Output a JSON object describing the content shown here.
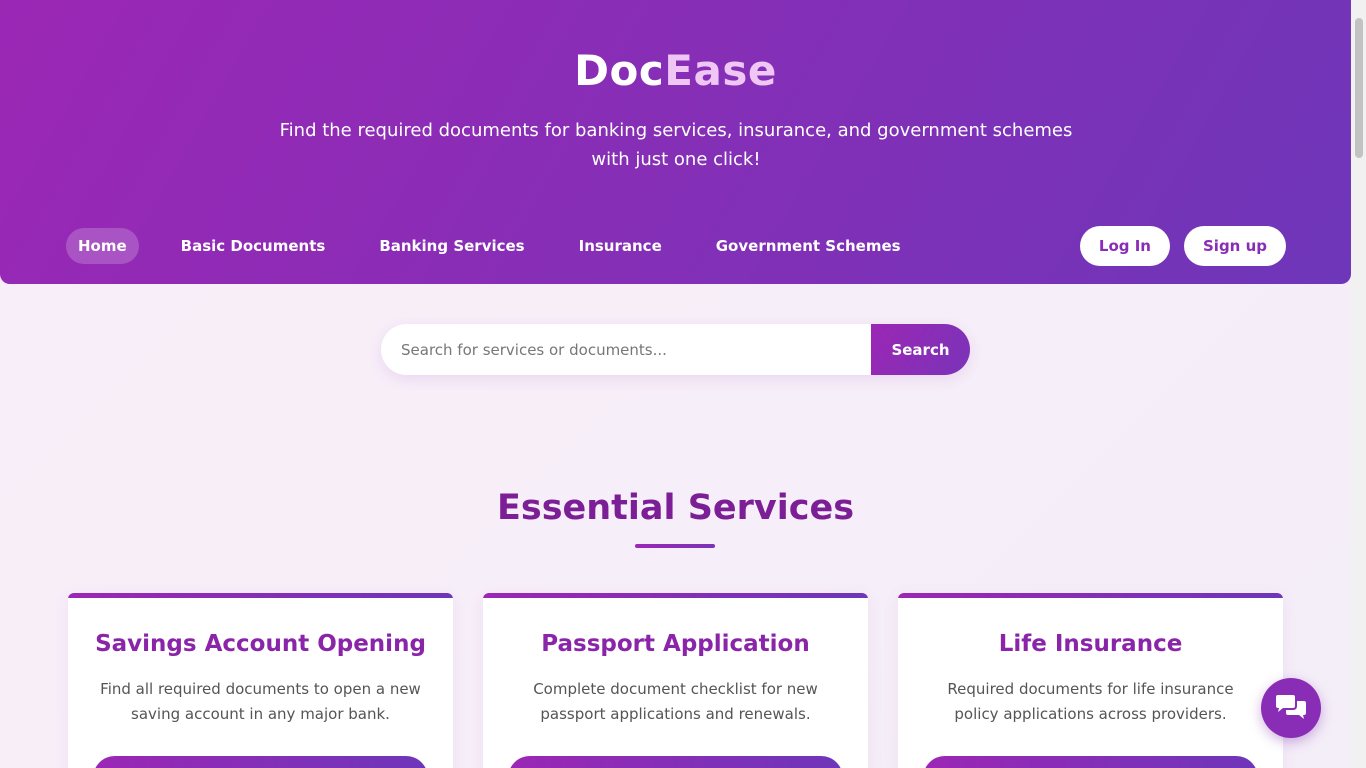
{
  "header": {
    "logo_part1": "Doc",
    "logo_part2": "Ease",
    "tagline": "Find the required documents for banking services, insurance, and government schemes with just one click!"
  },
  "nav": {
    "items": [
      {
        "label": "Home",
        "active": true
      },
      {
        "label": "Basic Documents"
      },
      {
        "label": "Banking Services"
      },
      {
        "label": "Insurance"
      },
      {
        "label": "Government Schemes"
      }
    ],
    "login_label": "Log In",
    "signup_label": "Sign up"
  },
  "search": {
    "placeholder": "Search for services or documents...",
    "button_label": "Search"
  },
  "section": {
    "title": "Essential Services"
  },
  "cards": [
    {
      "title": "Savings Account Opening",
      "description": "Find all required documents to open a new saving account in any major bank."
    },
    {
      "title": "Passport Application",
      "description": "Complete document checklist for new passport applications and renewals."
    },
    {
      "title": "Life Insurance",
      "description": "Required documents for life insurance policy applications across providers."
    }
  ],
  "chat": {
    "icon": "chat-bubbles-icon"
  },
  "colors": {
    "brand_purple": "#8a2db6",
    "brand_magenta": "#9b27b5",
    "brand_violet": "#6e36b9",
    "logo_accent": "#f0c6f4",
    "heading": "#7c1f97"
  }
}
